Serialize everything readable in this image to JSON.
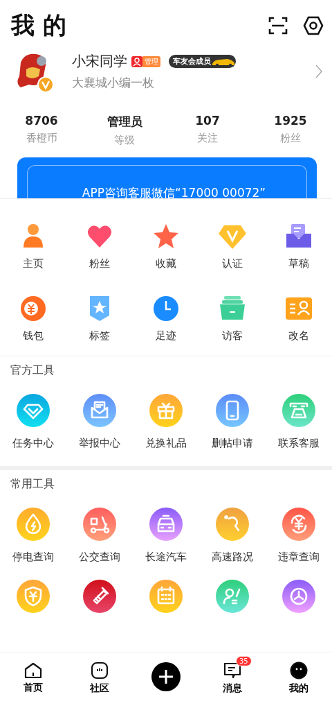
{
  "header": {
    "title": "我 的"
  },
  "profile": {
    "name": "小宋同学",
    "role_badge": "管理",
    "member_badge": "车友会成员",
    "bio": "大襄城小编一枚"
  },
  "stats": [
    {
      "value": "8706",
      "label": "香橙币"
    },
    {
      "value": "管理员",
      "label": "等级"
    },
    {
      "value": "107",
      "label": "关注"
    },
    {
      "value": "1925",
      "label": "粉丝"
    }
  ],
  "banner": {
    "text": "APP咨询客服微信“17000 00072”"
  },
  "shortcuts": [
    {
      "label": "主页"
    },
    {
      "label": "粉丝"
    },
    {
      "label": "收藏"
    },
    {
      "label": "认证"
    },
    {
      "label": "草稿"
    },
    {
      "label": "钱包"
    },
    {
      "label": "标签"
    },
    {
      "label": "足迹"
    },
    {
      "label": "访客"
    },
    {
      "label": "改名"
    }
  ],
  "sections": [
    {
      "title": "官方工具",
      "tools": [
        {
          "kind": "labeled",
          "label": "任务中心"
        },
        {
          "kind": "labeled",
          "label": "举报中心"
        },
        {
          "kind": "labeled",
          "label": "兑换礼品"
        },
        {
          "kind": "labeled",
          "label": "删帖申请"
        },
        {
          "kind": "labeled",
          "label": "联系客服"
        }
      ]
    },
    {
      "title": "常用工具",
      "tools": [
        {
          "kind": "labeled",
          "label": "停电查询"
        },
        {
          "kind": "labeled",
          "label": "公交查询"
        },
        {
          "kind": "labeled",
          "label": "长途汽车"
        },
        {
          "kind": "labeled",
          "label": "高速路况"
        },
        {
          "kind": "labeled",
          "label": "违章查询"
        },
        {
          "kind": "icon-only"
        },
        {
          "kind": "icon-only"
        },
        {
          "kind": "icon-only"
        },
        {
          "kind": "icon-only"
        },
        {
          "kind": "icon-only"
        }
      ]
    }
  ],
  "tab_bar": [
    {
      "kind": "tab",
      "label": "首页",
      "selected": false
    },
    {
      "kind": "tab",
      "label": "社区",
      "selected": false
    },
    {
      "kind": "action"
    },
    {
      "kind": "tab",
      "label": "消息",
      "selected": false,
      "badge": "35"
    },
    {
      "kind": "tab",
      "label": "我的",
      "selected": true
    }
  ]
}
